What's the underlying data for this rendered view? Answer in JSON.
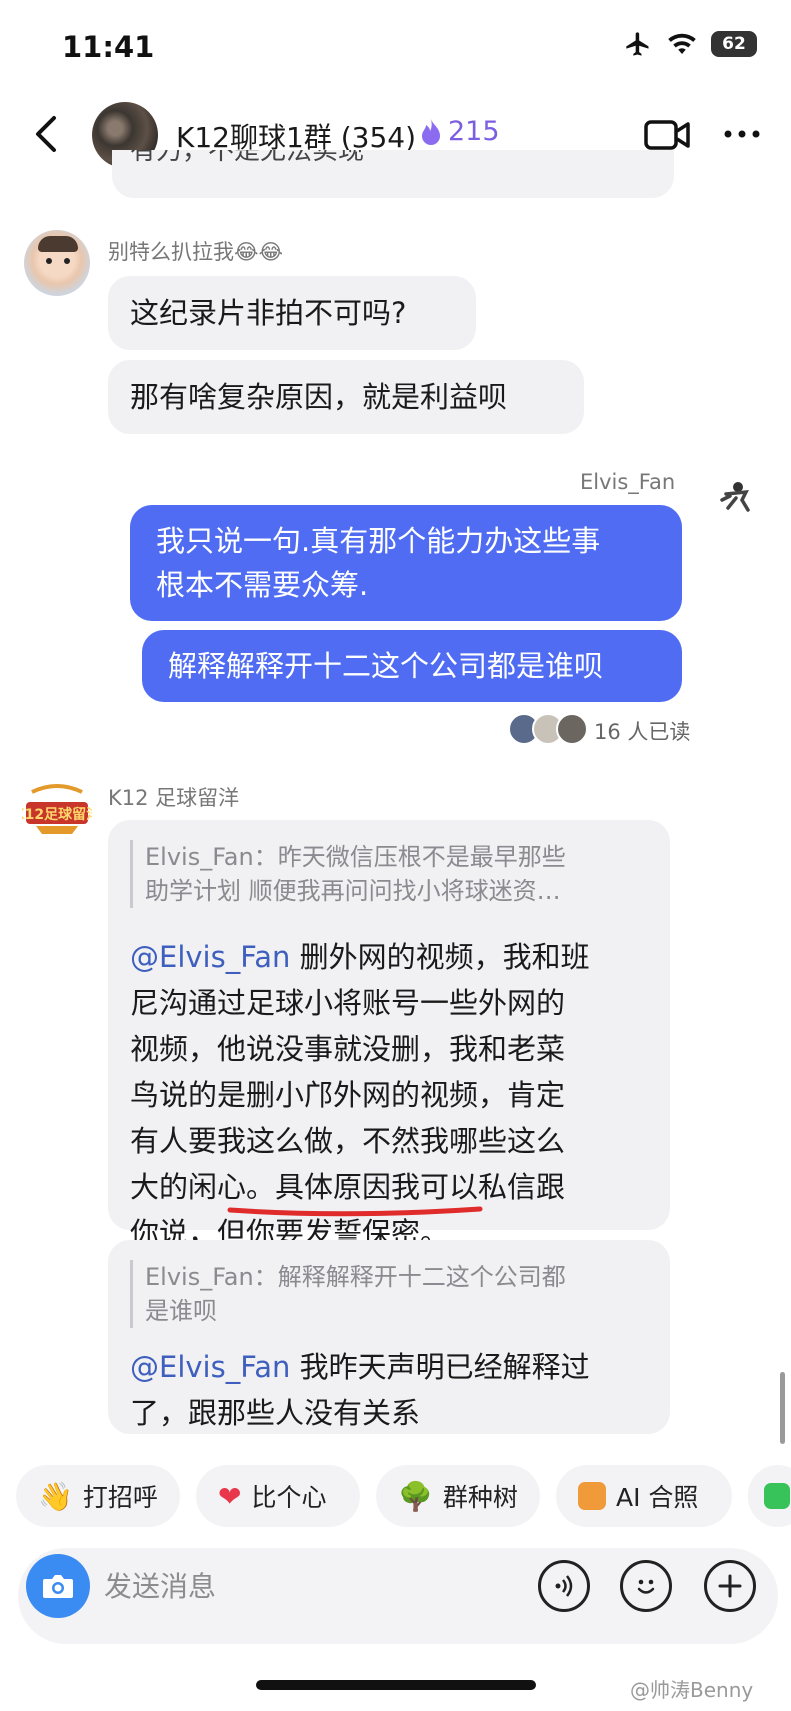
{
  "status_bar": {
    "time": "11:41",
    "battery": "62"
  },
  "header": {
    "title": "K12聊球1群 (354)",
    "fire_count": "215"
  },
  "messages": {
    "partial_top": "有力，不是无法实现",
    "m1": {
      "sender": "别特么扒拉我😂😂",
      "bubble1": "这纪录片非拍不可吗?",
      "bubble2": "那有啥复杂原因，就是利益呗"
    },
    "m2": {
      "sender": "Elvis_Fan",
      "bubble1_line1": "我只说一句.真有那个能力办这些事",
      "bubble1_line2": "根本不需要众筹.",
      "bubble2": "解释解释开十二这个公司都是谁呗",
      "read_receipt": "16 人已读"
    },
    "m3": {
      "sender": "K12 足球留洋",
      "reply1": {
        "quote_line1": "Elvis_Fan：昨天微信压根不是最早那些",
        "quote_line2": "助学计划 顺便我再问问找小将球迷资…",
        "mention": "@Elvis_Fan",
        "line1": " 删外网的视频，我和班",
        "line2": "尼沟通过足球小将账号一些外网的",
        "line3": "视频，他说没事就没删，我和老菜",
        "line4": "鸟说的是删小邝外网的视频，肯定",
        "line5": "有人要我这么做，不然我哪些这么",
        "line6": "大的闲心。具体原因我可以私信跟",
        "line7": "你说，但你要发誓保密。"
      },
      "reply2": {
        "quote_line1": "Elvis_Fan：解释解释开十二这个公司都",
        "quote_line2": "是谁呗",
        "mention": "@Elvis_Fan",
        "line1": " 我昨天声明已经解释过",
        "line2": "了，跟那些人没有关系"
      }
    }
  },
  "quick_actions": [
    {
      "label": "打招呼",
      "icon": "wave-hand-icon"
    },
    {
      "label": "比个心",
      "icon": "heart-icon"
    },
    {
      "label": "群种树",
      "icon": "tree-icon"
    },
    {
      "label": "AI 合照",
      "icon": "ai-photo-icon"
    }
  ],
  "input": {
    "placeholder": "发送消息"
  },
  "watermark": "@帅涛Benny",
  "colors": {
    "outgoing_bubble": "#4f6cf2",
    "incoming_bubble": "#f1f1f3",
    "mention": "#3f5fbf",
    "fire": "#7b5fe0",
    "camera": "#3a8bf2",
    "underline": "#e02b2b"
  }
}
